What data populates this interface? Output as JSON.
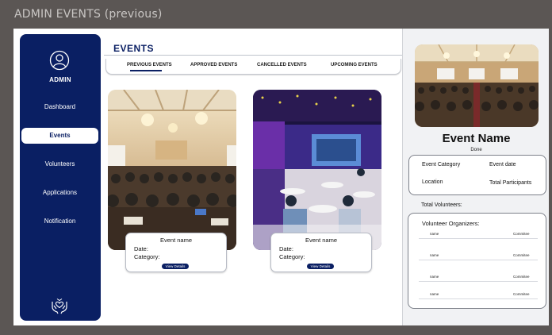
{
  "frame": {
    "title": "ADMIN EVENTS (previous)"
  },
  "sidebar": {
    "admin_label": "ADMIN",
    "items": [
      {
        "label": "Dashboard",
        "active": false
      },
      {
        "label": "Events",
        "active": true
      },
      {
        "label": "Volunteers",
        "active": false
      },
      {
        "label": "Applications",
        "active": false
      },
      {
        "label": "Notification",
        "active": false
      }
    ]
  },
  "main": {
    "title": "EVENTS",
    "tabs": [
      {
        "label": "PREVIOUS EVENTS",
        "active": true
      },
      {
        "label": "APPROVED EVENTS",
        "active": false
      },
      {
        "label": "CANCELLED EVENTS",
        "active": false
      },
      {
        "label": "UPCOMING EVENTS",
        "active": false
      }
    ],
    "cards": [
      {
        "name": "Event name",
        "date_label": "Date:",
        "category_label": "Category:",
        "button": "View Details"
      },
      {
        "name": "Event name",
        "date_label": "Date:",
        "category_label": "Category:",
        "button": "View Details"
      }
    ]
  },
  "details": {
    "title": "Event Name",
    "status": "Done",
    "fields": {
      "category": "Event Category",
      "date": "Event date",
      "location": "Location",
      "participants": "Total Participants"
    },
    "total_volunteers_label": "Total Volunteers:",
    "volunteer_organizers_label": "Volunteer Organizers:",
    "organizers": [
      {
        "name": "name",
        "role": "Commitee"
      },
      {
        "name": "name",
        "role": "Commitee"
      },
      {
        "name": "name",
        "role": "Commitee"
      },
      {
        "name": "name",
        "role": "Commitee"
      }
    ]
  },
  "colors": {
    "sidebar": "#0a1f63",
    "accent": "#0a1f63",
    "background": "#5b5654"
  },
  "icons": {
    "avatar": "user-circle-icon",
    "logo": "hands-heart-icon"
  }
}
